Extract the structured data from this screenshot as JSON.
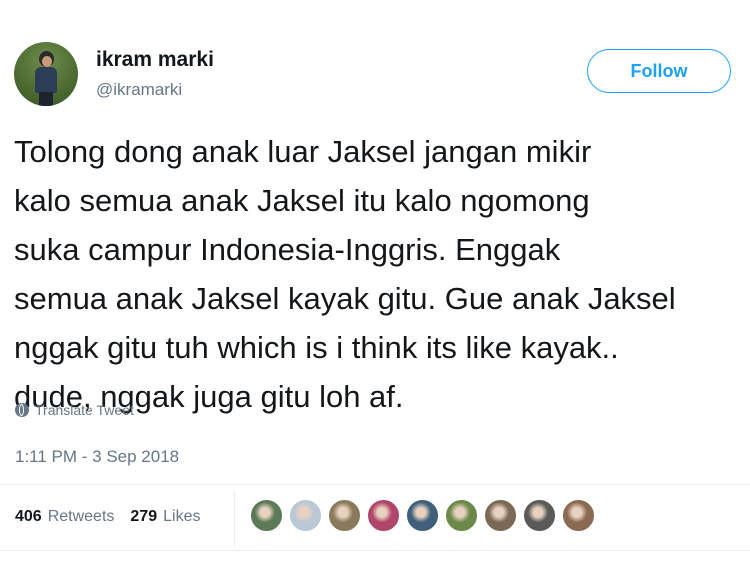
{
  "user": {
    "name": "ikram marki",
    "handle": "@ikramarki"
  },
  "follow_label": "Follow",
  "tweet": {
    "lines": [
      "Tolong dong anak luar Jaksel jangan mikir",
      "kalo semua anak Jaksel itu kalo ngomong",
      "suka campur Indonesia-Inggris. Enggak",
      "semua anak Jaksel kayak gitu. Gue anak Jaksel",
      "nggak gitu tuh which is i think its like kayak..",
      "dude, nggak juga gitu loh af."
    ]
  },
  "translate_label": "Translate Tweet",
  "timestamp": "1:11 PM - 3 Sep 2018",
  "stats": {
    "retweets_count": "406",
    "retweets_label": "Retweets",
    "likes_count": "279",
    "likes_label": "Likes"
  },
  "likers": [
    {
      "color": "#5b7a55"
    },
    {
      "color": "#b9c7d6"
    },
    {
      "color": "#8a7a5c"
    },
    {
      "color": "#b0456a"
    },
    {
      "color": "#3f5f7a"
    },
    {
      "color": "#6b8a4a"
    },
    {
      "color": "#7a6a55"
    },
    {
      "color": "#5a5a5a"
    },
    {
      "color": "#8a6a52"
    }
  ],
  "colors": {
    "accent": "#1da1f2",
    "text": "#14171a",
    "muted": "#657786"
  }
}
